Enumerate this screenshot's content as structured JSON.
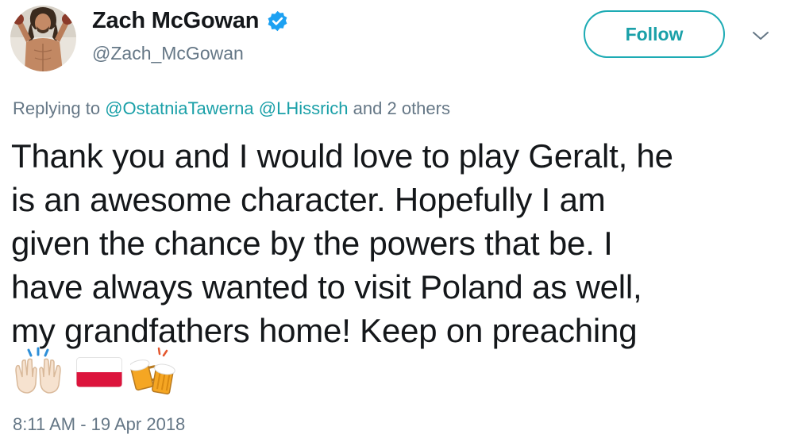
{
  "user": {
    "display_name": "Zach McGowan",
    "handle": "@Zach_McGowan",
    "verified_icon": "verified-badge-icon",
    "avatar": "profile-photo"
  },
  "actions": {
    "follow_label": "Follow",
    "more_icon": "chevron-down-icon"
  },
  "reply": {
    "prefix": "Replying to",
    "mentions": [
      "@OstatniaTawerna",
      "@LHissrich"
    ],
    "suffix": "and 2 others"
  },
  "tweet": {
    "text": "Thank you and I would love to play Geralt, he\nis an awesome character.  Hopefully I am\ngiven the chance by the powers that be. I\nhave always wanted to visit Poland as well,\nmy grandfathers home! Keep on preaching",
    "emojis": [
      "raising-hands-emoji",
      "poland-flag-emoji",
      "clinking-beer-mugs-emoji"
    ]
  },
  "meta": {
    "timestamp": "8:11 AM - 19 Apr 2018"
  },
  "colors": {
    "accent": "#1aa0a8",
    "verified": "#1da1f2",
    "secondary_text": "#657786",
    "primary_text": "#14171a"
  }
}
